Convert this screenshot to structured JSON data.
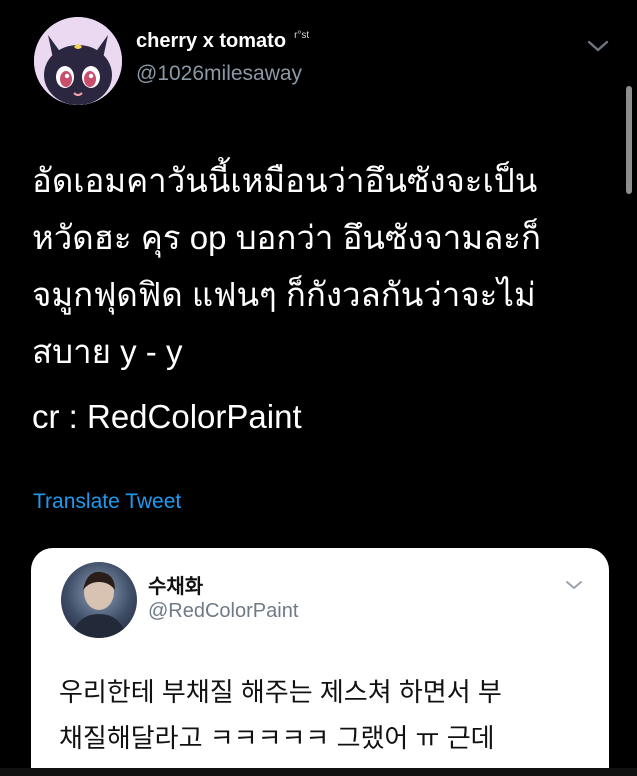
{
  "author": {
    "display_name": "cherry x tomato",
    "name_badge": "r°st",
    "handle": "@1026milesaway",
    "avatar_icon": "black-cat-avatar-icon"
  },
  "more_icon": "chevron-down-icon",
  "tweet": {
    "lines": [
      "อัดเอมคาวันนี้เหมือนว่าอึนซังจะเป็น",
      "หวัดฮะ คุร op บอกว่า อึนซังจามละก็",
      "จมูกฟุดฟิด แฟนๆ ก็กังวลกันว่าจะไม่",
      "สบาย y - y"
    ],
    "credit": "cr : RedColorPaint",
    "translate_label": "Translate Tweet"
  },
  "quoted": {
    "display_name": "수채화",
    "handle": "@RedColorPaint",
    "avatar_icon": "user-photo-avatar",
    "lines": [
      "우리한테 부채질 해주는 제스쳐 하면서 부",
      "채질해달라고 ㅋㅋㅋㅋㅋ 그랬어 ㅠ 근데"
    ]
  },
  "colors": {
    "background": "#000000",
    "link": "#1d9bf0",
    "handle": "#8b98a5",
    "card": "#ffffff"
  }
}
